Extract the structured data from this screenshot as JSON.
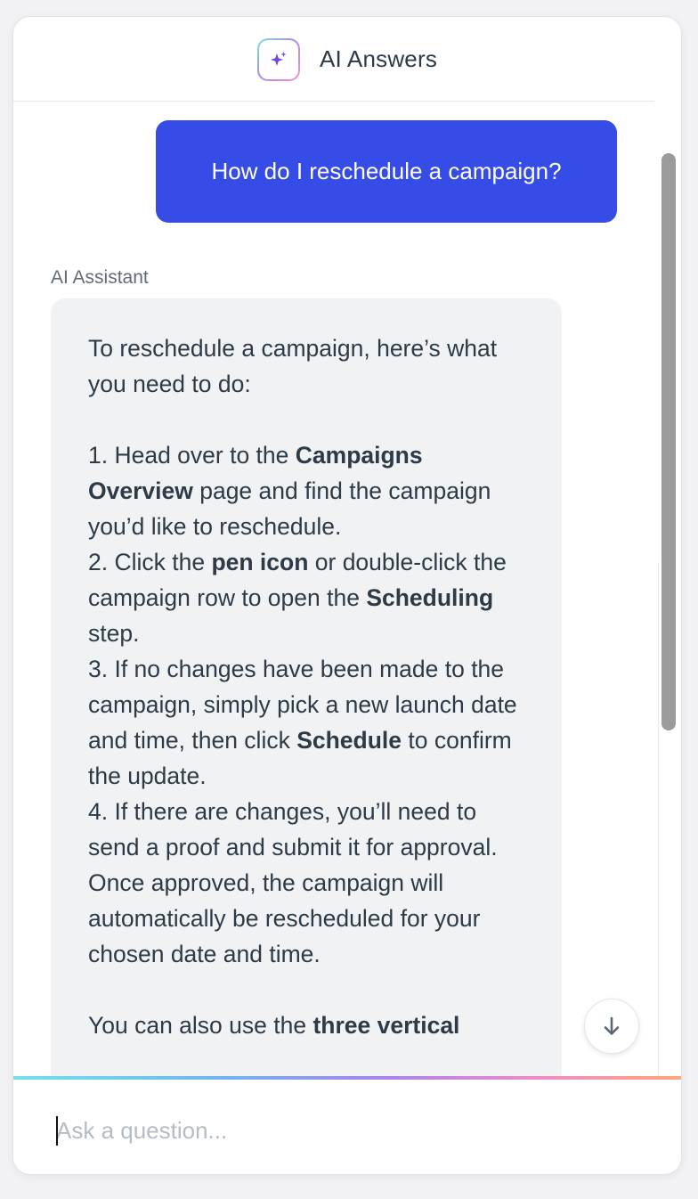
{
  "header": {
    "title": "AI Answers",
    "logo_icon": "sparkles-icon"
  },
  "conversation": {
    "user_message": "How do I reschedule a campaign?",
    "assistant_label": "AI Assistant",
    "assistant_message": {
      "intro": "To reschedule a campaign, here’s what you need to do:",
      "steps": [
        {
          "prefix": "1. Head over to the ",
          "bold1": "Campaigns Overview",
          "middle": " page and find the campaign you’d like to reschedule.",
          "bold2": "",
          "suffix": ""
        },
        {
          "prefix": "2. Click the ",
          "bold1": "pen icon",
          "middle": " or double-click the campaign row to open the ",
          "bold2": "Scheduling",
          "suffix": " step."
        },
        {
          "prefix": "3. If no changes have been made to the campaign, simply pick a new launch date and time, then click ",
          "bold1": "Schedule",
          "middle": " to confirm the update.",
          "bold2": "",
          "suffix": ""
        },
        {
          "prefix": "4. If there are changes, you’ll need to send a proof and submit it for approval. Once approved, the campaign will automatically be rescheduled for your chosen date and time.",
          "bold1": "",
          "middle": "",
          "bold2": "",
          "suffix": ""
        }
      ],
      "outro_prefix": "You can also use the ",
      "outro_bold": "three vertical"
    }
  },
  "scroll_down_icon": "arrow-down-icon",
  "input": {
    "placeholder": "Ask a question...",
    "value": ""
  },
  "colors": {
    "user_bubble": "#354ce6",
    "assistant_bubble": "#f1f2f4",
    "scrollbar_thumb": "#9b9b9b",
    "gradient": [
      "#6fe3ea",
      "#6fb7ef",
      "#a784ee",
      "#ef8ac8",
      "#ffa77a"
    ]
  }
}
